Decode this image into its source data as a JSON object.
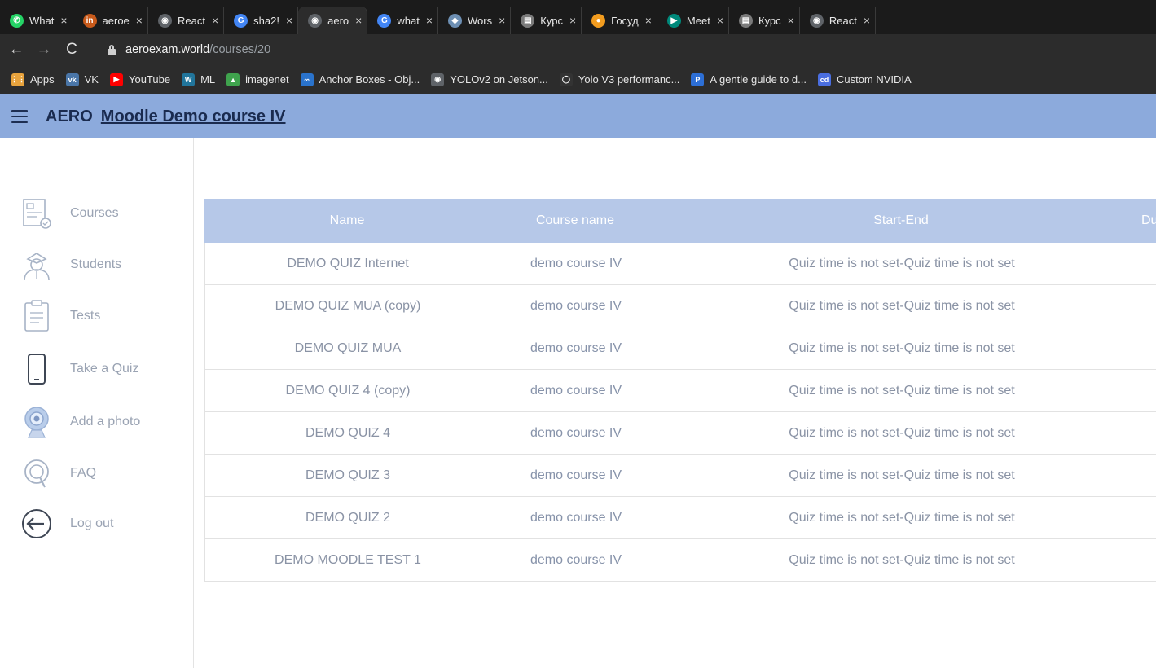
{
  "browser": {
    "tabs": [
      {
        "label": "What",
        "favicon": "whatsapp-icon",
        "color": "#25d366",
        "glyph": "✆"
      },
      {
        "label": "aeroe",
        "favicon": "linkedin-icon",
        "color": "#c85a1b",
        "glyph": "in"
      },
      {
        "label": "React",
        "favicon": "globe-icon",
        "color": "#5f6368",
        "glyph": "◉"
      },
      {
        "label": "sha2!",
        "favicon": "google-icon",
        "color": "#4285f4",
        "glyph": "G"
      },
      {
        "label": "aero",
        "favicon": "globe-icon",
        "color": "#5f6368",
        "glyph": "◉",
        "active": true
      },
      {
        "label": "what",
        "favicon": "google-icon",
        "color": "#4285f4",
        "glyph": "G"
      },
      {
        "label": "Wors",
        "favicon": "shield-icon",
        "color": "#6d8fb3",
        "glyph": "◆"
      },
      {
        "label": "Курс",
        "favicon": "document-icon",
        "color": "#7a7a7a",
        "glyph": "▤"
      },
      {
        "label": "Госуд",
        "favicon": "orange-globe-icon",
        "color": "#f29c1f",
        "glyph": "●"
      },
      {
        "label": "Meet",
        "favicon": "meet-icon",
        "color": "#00897b",
        "glyph": "▶"
      },
      {
        "label": "Курс",
        "favicon": "document-icon",
        "color": "#7a7a7a",
        "glyph": "▤"
      },
      {
        "label": "React",
        "favicon": "globe-icon",
        "color": "#5f6368",
        "glyph": "◉"
      }
    ],
    "tab_close": "×",
    "url_host": "aeroexam.world",
    "url_path": "/courses/20",
    "bookmarks": [
      {
        "label": "Apps",
        "icon": "apps-grid-icon",
        "color": "#e8a33d",
        "glyph": "⋮⋮"
      },
      {
        "label": "VK",
        "icon": "vk-icon",
        "color": "#4a76a8",
        "glyph": "vk"
      },
      {
        "label": "YouTube",
        "icon": "youtube-icon",
        "color": "#ff0000",
        "glyph": "▶"
      },
      {
        "label": "ML",
        "icon": "wordpress-icon",
        "color": "#21759b",
        "glyph": "W"
      },
      {
        "label": "imagenet",
        "icon": "imagenet-icon",
        "color": "#3fa34d",
        "glyph": "▲"
      },
      {
        "label": "Anchor Boxes - Obj...",
        "icon": "coursera-icon",
        "color": "#2a73cc",
        "glyph": "∞"
      },
      {
        "label": "YOLOv2 on Jetson...",
        "icon": "globe-icon",
        "color": "#5f6368",
        "glyph": "◉"
      },
      {
        "label": "Yolo V3 performanc...",
        "icon": "github-icon",
        "color": "#333333",
        "glyph": "◯"
      },
      {
        "label": "A gentle guide to d...",
        "icon": "p-icon",
        "color": "#2d6fd6",
        "glyph": "P"
      },
      {
        "label": "Custom NVIDIA",
        "icon": "cd-icon",
        "color": "#4a6ee0",
        "glyph": "cd"
      }
    ]
  },
  "header": {
    "brand": "AERO",
    "course_title": "Moodle Demo course IV"
  },
  "sidebar": {
    "items": [
      {
        "label": "Courses",
        "icon": "courses-icon"
      },
      {
        "label": "Students",
        "icon": "students-icon"
      },
      {
        "label": "Tests",
        "icon": "tests-icon"
      },
      {
        "label": "Take a Quiz",
        "icon": "phone-icon"
      },
      {
        "label": "Add a photo",
        "icon": "webcam-icon"
      },
      {
        "label": "FAQ",
        "icon": "faq-icon"
      },
      {
        "label": "Log out",
        "icon": "logout-icon"
      }
    ]
  },
  "table": {
    "columns": [
      "Name",
      "Course name",
      "Start-End",
      "Du"
    ],
    "rows": [
      {
        "name": "DEMO QUIZ Internet",
        "course": "demo course IV",
        "start_end": "Quiz time is not set-Quiz time is not set"
      },
      {
        "name": "DEMO QUIZ MUA (copy)",
        "course": "demo course IV",
        "start_end": "Quiz time is not set-Quiz time is not set"
      },
      {
        "name": "DEMO QUIZ MUA",
        "course": "demo course IV",
        "start_end": "Quiz time is not set-Quiz time is not set"
      },
      {
        "name": "DEMO QUIZ 4 (copy)",
        "course": "demo course IV",
        "start_end": "Quiz time is not set-Quiz time is not set"
      },
      {
        "name": "DEMO QUIZ 4",
        "course": "demo course IV",
        "start_end": "Quiz time is not set-Quiz time is not set"
      },
      {
        "name": "DEMO QUIZ 3",
        "course": "demo course IV",
        "start_end": "Quiz time is not set-Quiz time is not set"
      },
      {
        "name": "DEMO QUIZ 2",
        "course": "demo course IV",
        "start_end": "Quiz time is not set-Quiz time is not set"
      },
      {
        "name": "DEMO MOODLE TEST 1",
        "course": "demo course IV",
        "start_end": "Quiz time is not set-Quiz time is not set"
      }
    ]
  },
  "colors": {
    "header_bg": "#8caadc",
    "table_header_bg": "#b6c8e8",
    "muted_text": "#8a93a5"
  }
}
